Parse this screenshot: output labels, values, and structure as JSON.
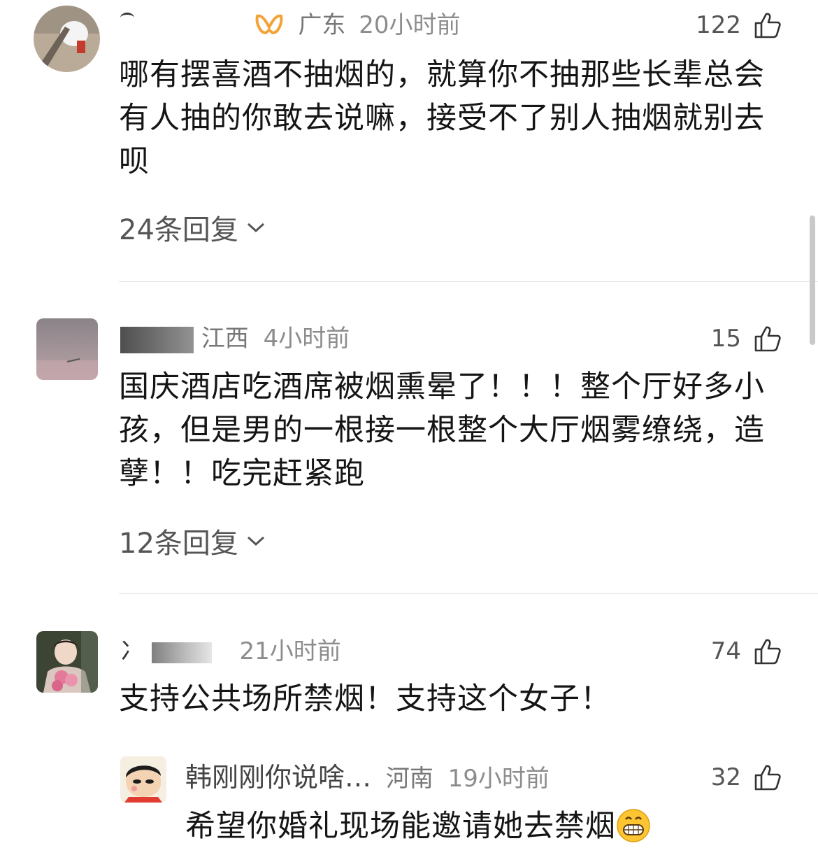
{
  "comments": [
    {
      "name_prefix": "",
      "location": "广东",
      "time": "20小时前",
      "likes": "122",
      "text": "哪有摆喜酒不抽烟的，就算你不抽那些长辈总会有人抽的你敢去说嘛，接受不了别人抽烟就别去呗",
      "replies": "24条回复",
      "badge_icon": "vip-badge-icon"
    },
    {
      "name_prefix": "",
      "location": "江西",
      "time": "4小时前",
      "likes": "15",
      "text": "国庆酒店吃酒席被烟熏晕了！！！整个厅好多小孩，但是男的一根接一根整个大厅烟雾缭绕，造孽！！吃完赶紧跑",
      "replies": "12条回复"
    },
    {
      "name_prefix": "",
      "location": "",
      "time": "21小时前",
      "likes": "74",
      "text": "支持公共场所禁烟！支持这个女子！"
    }
  ],
  "reply": {
    "name": "韩刚刚你说啥…",
    "location": "河南",
    "time": "19小时前",
    "likes": "32",
    "text": "希望你婚礼现场能邀请她去禁烟",
    "emoji": "grinning-face-emoji"
  }
}
